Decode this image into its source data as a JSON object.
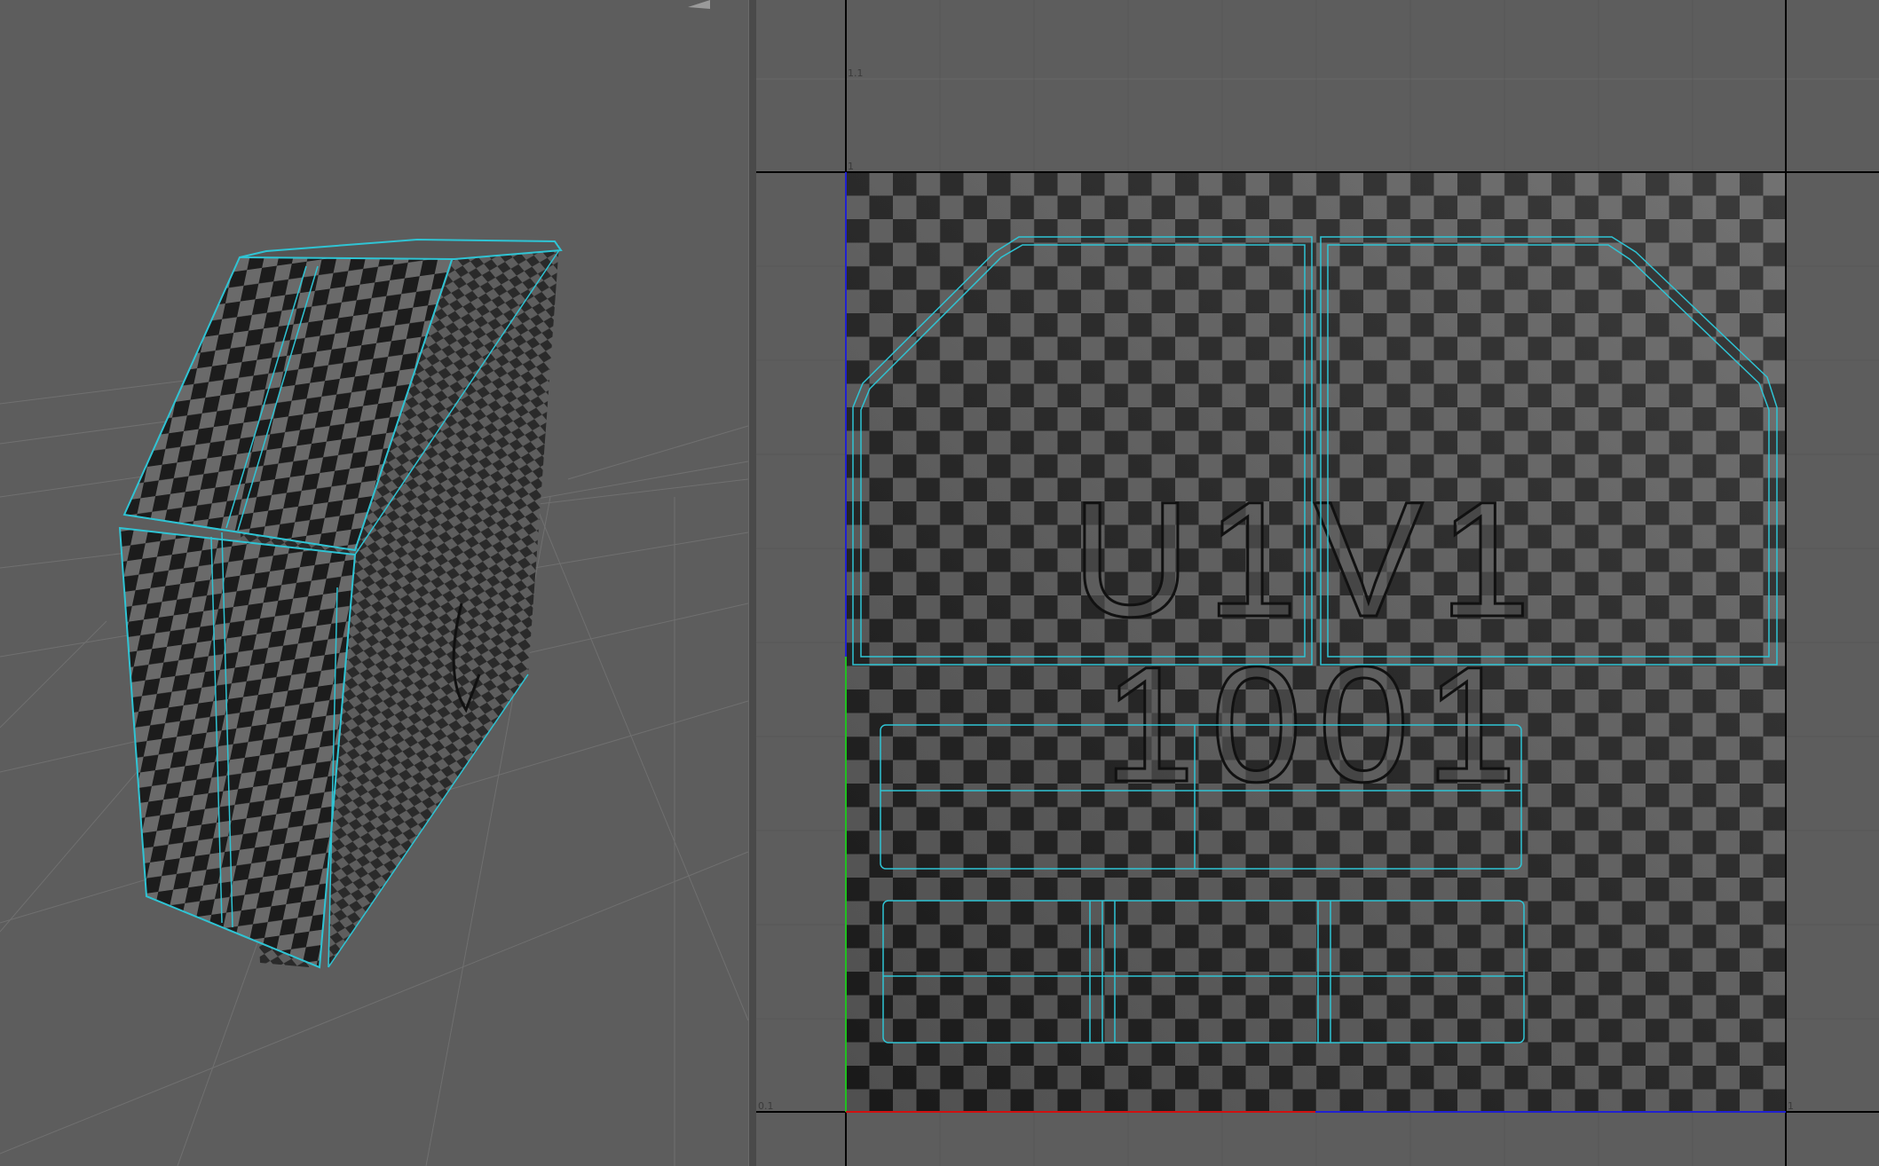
{
  "viewport_3d": {
    "name": "perspective-viewport",
    "corner_label": ""
  },
  "uv_editor": {
    "tile_labels": {
      "v_top": "1.1",
      "v_one": "1",
      "u_left": "0.1",
      "u_one": "1"
    },
    "texture_text": {
      "line1": "U1V1",
      "line2": "1001"
    },
    "colors": {
      "uv_shell": "#2fc4d4",
      "u_axis": "#d01010",
      "v_axis_lower": "#20c020",
      "v_axis_upper": "#2020d0",
      "checker_dark": "#1e1e1e",
      "checker_light": "#6a6a6a"
    }
  }
}
